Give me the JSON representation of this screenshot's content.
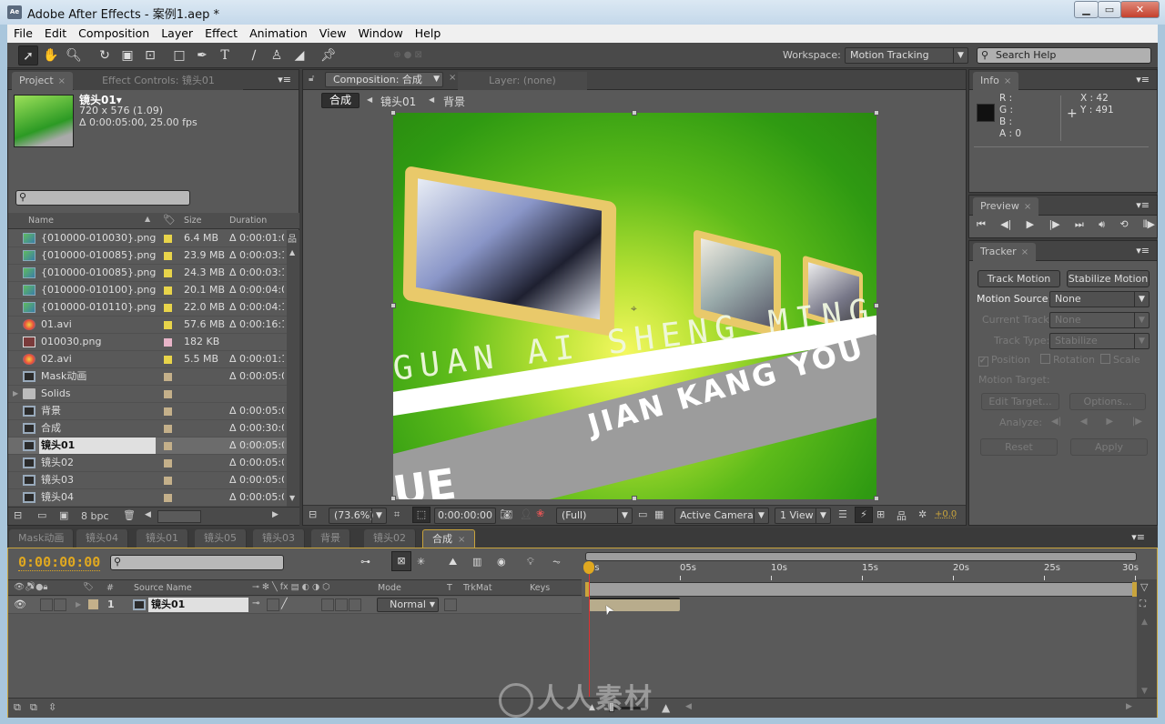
{
  "window": {
    "app_icon": "Ae",
    "title": "Adobe After Effects - 案例1.aep *"
  },
  "menu": [
    "File",
    "Edit",
    "Composition",
    "Layer",
    "Effect",
    "Animation",
    "View",
    "Window",
    "Help"
  ],
  "toolbar": {
    "tools": [
      "selection-tool",
      "hand-tool",
      "zoom-tool",
      "rotation-tool",
      "camera-tool",
      "pan-behind-tool",
      "rectangle-tool",
      "pen-tool",
      "type-tool",
      "brush-tool",
      "clone-stamp-tool",
      "eraser-tool",
      "puppet-pin-tool"
    ],
    "workspace_label": "Workspace:",
    "workspace_value": "Motion Tracking",
    "search_placeholder": "Search Help"
  },
  "project": {
    "tab": "Project",
    "effect_controls_tab": "Effect Controls: 镜头01",
    "selected_name": "镜头01▾",
    "selected_dims": "720 x 576 (1.09)",
    "selected_duration": "Δ 0:00:05:00, 25.00 fps",
    "search_placeholder": "",
    "columns": {
      "name": "Name",
      "size": "Size",
      "duration": "Duration"
    },
    "items": [
      {
        "name": "{010000-010030}.png",
        "type": "sequence",
        "label_color": "#e8d44a",
        "size": "6.4 MB",
        "duration": "Δ 0:00:01:0"
      },
      {
        "name": "{010000-010085}.png",
        "type": "sequence",
        "label_color": "#e8d44a",
        "size": "23.9 MB",
        "duration": "Δ 0:00:03:1"
      },
      {
        "name": "{010000-010085}.png",
        "type": "sequence",
        "label_color": "#e8d44a",
        "size": "24.3 MB",
        "duration": "Δ 0:00:03:1"
      },
      {
        "name": "{010000-010100}.png",
        "type": "sequence",
        "label_color": "#e8d44a",
        "size": "20.1 MB",
        "duration": "Δ 0:00:04:0"
      },
      {
        "name": "{010000-010110}.png",
        "type": "sequence",
        "label_color": "#e8d44a",
        "size": "22.0 MB",
        "duration": "Δ 0:00:04:1"
      },
      {
        "name": "01.avi",
        "type": "avi",
        "label_color": "#e8d44a",
        "size": "57.6 MB",
        "duration": "Δ 0:00:16:1"
      },
      {
        "name": "010030.png",
        "type": "png",
        "label_color": "#e8b4c8",
        "size": "182 KB",
        "duration": ""
      },
      {
        "name": "02.avi",
        "type": "avi",
        "label_color": "#e8d44a",
        "size": "5.5 MB",
        "duration": "Δ 0:00:01:1"
      },
      {
        "name": "Mask动画",
        "type": "comp",
        "label_color": "#c4b08a",
        "size": "",
        "duration": "Δ 0:00:05:0"
      },
      {
        "name": "Solids",
        "type": "folder",
        "label_color": "#c4b08a",
        "size": "",
        "duration": ""
      },
      {
        "name": "背景",
        "type": "comp",
        "label_color": "#c4b08a",
        "size": "",
        "duration": "Δ 0:00:05:0"
      },
      {
        "name": "合成",
        "type": "comp",
        "label_color": "#c4b08a",
        "size": "",
        "duration": "Δ 0:00:30:0"
      },
      {
        "name": "镜头01",
        "type": "comp",
        "label_color": "#c4b08a",
        "size": "",
        "duration": "Δ 0:00:05:0",
        "selected": true
      },
      {
        "name": "镜头02",
        "type": "comp",
        "label_color": "#c4b08a",
        "size": "",
        "duration": "Δ 0:00:05:0"
      },
      {
        "name": "镜头03",
        "type": "comp",
        "label_color": "#c4b08a",
        "size": "",
        "duration": "Δ 0:00:05:0"
      },
      {
        "name": "镜头04",
        "type": "comp",
        "label_color": "#c4b08a",
        "size": "",
        "duration": "Δ 0:00:05:0"
      }
    ],
    "bpc": "8 bpc"
  },
  "composition": {
    "tab": "Composition: 合成",
    "layer_tab": "Layer: (none)",
    "breadcrumbs": [
      "合成",
      "镜头01",
      "背景"
    ],
    "viewer_text": {
      "line1": "GUAN AI SHENG MING",
      "line1_repeat": "GUAN AI S",
      "line2": "JIAN KANG YOU YUE",
      "line3": "UE"
    },
    "zoom": "(73.6%)",
    "timecode": "0:00:00:00",
    "resolution": "(Full)",
    "camera": "Active Camera",
    "views": "1 View",
    "exposure": "+0.0"
  },
  "info": {
    "tab": "Info",
    "r_label": "R :",
    "g_label": "G :",
    "b_label": "B :",
    "a_label": "A : 0",
    "x": "X : 42",
    "y": "Y : 491"
  },
  "preview": {
    "tab": "Preview"
  },
  "tracker": {
    "tab": "Tracker",
    "track_motion": "Track Motion",
    "stabilize_motion": "Stabilize Motion",
    "motion_source_label": "Motion Source:",
    "motion_source_value": "None",
    "current_track_label": "Current Track:",
    "current_track_value": "None",
    "track_type_label": "Track Type:",
    "track_type_value": "Stabilize",
    "position": "Position",
    "rotation": "Rotation",
    "scale": "Scale",
    "position_checked": true,
    "motion_target_label": "Motion Target:",
    "edit_target": "Edit Target...",
    "options": "Options...",
    "analyze_label": "Analyze:",
    "reset": "Reset",
    "apply": "Apply"
  },
  "timeline": {
    "tabs": [
      "Mask动画",
      "镜头04",
      "镜头01",
      "镜头05",
      "镜头03",
      "背景",
      "镜头02",
      "合成"
    ],
    "active_tab": "合成",
    "timecode": "0:00:00:00",
    "columns": {
      "source_name": "Source Name",
      "mode": "Mode",
      "t": "T",
      "trkmat": "TrkMat",
      "keys": "Keys",
      "number": "#"
    },
    "ruler": [
      "0s",
      "05s",
      "10s",
      "15s",
      "20s",
      "25s",
      "30s"
    ],
    "layers": [
      {
        "number": "1",
        "name": "镜头01",
        "mode": "Normal",
        "in_s": 0,
        "out_s": 5
      }
    ],
    "duration_s": 30,
    "playhead_s": 0
  },
  "watermark": "人人素材"
}
